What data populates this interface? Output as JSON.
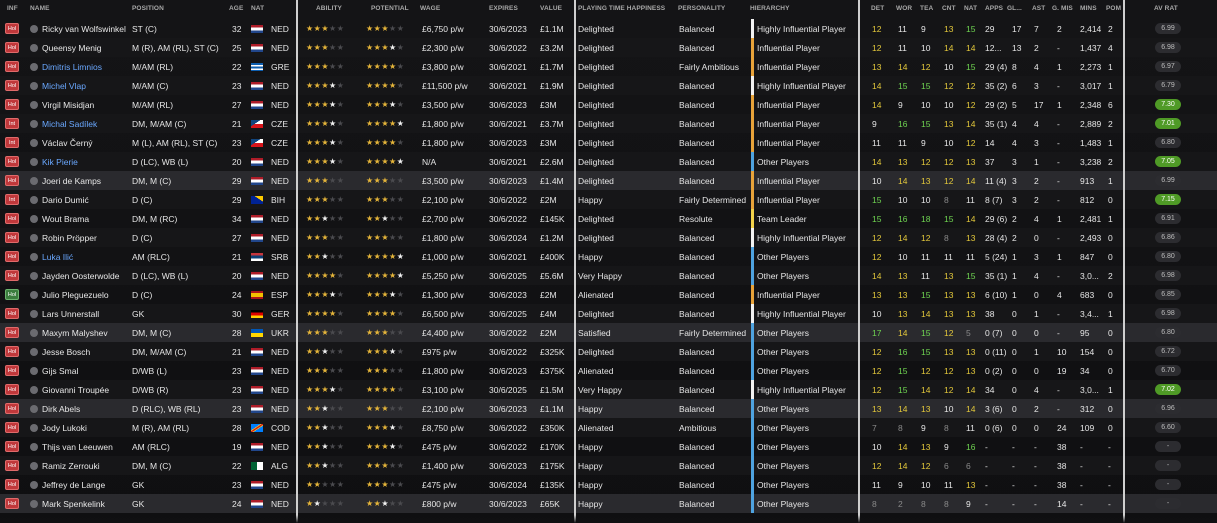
{
  "columns": {
    "inf": "INF",
    "name": "NAME",
    "position": "POSITION",
    "age": "AGE",
    "nat": "NAT",
    "ability": "ABILITY",
    "potential": "POTENTIAL",
    "wage": "WAGE",
    "expires": "EXPIRES",
    "value": "VALUE",
    "happiness": "PLAYING TIME HAPPINESS",
    "personality": "PERSONALITY",
    "hierarchy": "HIERARCHY",
    "det": "DET",
    "wor": "WOR",
    "tea": "TEA",
    "cnt": "CNT",
    "nat2": "NAT",
    "apps": "APPS",
    "gls": "GL...",
    "ast": "AST",
    "gmis": "G. MIS",
    "mins": "MINS",
    "pom": "POM",
    "avrat": "AV RAT"
  },
  "colors": {
    "Highly Influential Player": "#f2f2f2",
    "Influential Player": "#e8a33a",
    "Team Leader": "#f2d24a",
    "Other Players": "#4fa3e0",
    "flag_icons": "flag-icons"
  },
  "rows": [
    {
      "inf": "Hol",
      "ig": 0,
      "name": "Ricky van Wolfswinkel",
      "blue": 0,
      "pos": "ST (C)",
      "age": "32",
      "nat": "NED",
      "ab": 3,
      "pot": 3,
      "wage": "£6,750 p/w",
      "exp": "30/6/2023",
      "val": "£1.1M",
      "hap": "Delighted",
      "per": "Balanced",
      "hie": "Highly Influential Player",
      "det": "12",
      "wor": "11",
      "tea": "9",
      "cnt": "13",
      "nat2": "15",
      "apps": "29",
      "gls": "17",
      "ast": "7",
      "gmis": "2",
      "mins": "2,414",
      "pom": "2",
      "rat": "6.99",
      "hi": 0
    },
    {
      "inf": "Hol",
      "ig": 0,
      "name": "Queensy Menig",
      "blue": 0,
      "pos": "M (R), AM (RL), ST (C)",
      "age": "25",
      "nat": "NED",
      "ab": 3,
      "pot": 3.5,
      "wage": "£2,300 p/w",
      "exp": "30/6/2022",
      "val": "£3.2M",
      "hap": "Delighted",
      "per": "Balanced",
      "hie": "Influential Player",
      "det": "12",
      "wor": "11",
      "tea": "10",
      "cnt": "14",
      "nat2": "14",
      "apps": "12...",
      "gls": "13",
      "ast": "2",
      "gmis": "-",
      "mins": "1,437",
      "pom": "4",
      "rat": "6.98",
      "hi": 0
    },
    {
      "inf": "Hol",
      "ig": 0,
      "name": "Dimitris Limnios",
      "blue": 1,
      "pos": "M/AM (RL)",
      "age": "22",
      "nat": "GRE",
      "ab": 3,
      "pot": 4,
      "wage": "£3,800 p/w",
      "exp": "30/6/2021",
      "val": "£1.7M",
      "hap": "Delighted",
      "per": "Fairly Ambitious",
      "hie": "Influential Player",
      "det": "13",
      "wor": "14",
      "tea": "12",
      "cnt": "10",
      "nat2": "15",
      "apps": "29 (4)",
      "gls": "8",
      "ast": "4",
      "gmis": "1",
      "mins": "2,273",
      "pom": "1",
      "rat": "6.97",
      "hi": 0
    },
    {
      "inf": "Hol",
      "ig": 0,
      "name": "Michel Vlap",
      "blue": 1,
      "pos": "M/AM (C)",
      "age": "23",
      "nat": "NED",
      "ab": 3.5,
      "pot": 4,
      "wage": "£11,500 p/w",
      "exp": "30/6/2021",
      "val": "£1.9M",
      "hap": "Delighted",
      "per": "Balanced",
      "hie": "Highly Influential Player",
      "det": "14",
      "wor": "15",
      "tea": "15",
      "cnt": "12",
      "nat2": "12",
      "apps": "35 (2)",
      "gls": "6",
      "ast": "3",
      "gmis": "-",
      "mins": "3,017",
      "pom": "1",
      "rat": "6.79",
      "hi": 0
    },
    {
      "inf": "Hol",
      "ig": 0,
      "name": "Virgil Misidjan",
      "blue": 0,
      "pos": "M/AM (RL)",
      "age": "27",
      "nat": "NED",
      "ab": 3.5,
      "pot": 3.5,
      "wage": "£3,500 p/w",
      "exp": "30/6/2023",
      "val": "£3M",
      "hap": "Delighted",
      "per": "Balanced",
      "hie": "Influential Player",
      "det": "14",
      "wor": "9",
      "tea": "10",
      "cnt": "10",
      "nat2": "12",
      "apps": "29 (2)",
      "gls": "5",
      "ast": "17",
      "gmis": "1",
      "mins": "2,348",
      "pom": "6",
      "rat": "7.30",
      "hi": 1
    },
    {
      "inf": "Int",
      "ig": 0,
      "name": "Michal Sadílek",
      "blue": 1,
      "pos": "DM, M/AM (C)",
      "age": "21",
      "nat": "CZE",
      "ab": 3.5,
      "pot": 4.5,
      "wage": "£1,800 p/w",
      "exp": "30/6/2021",
      "val": "£3.7M",
      "hap": "Delighted",
      "per": "Balanced",
      "hie": "Influential Player",
      "det": "9",
      "wor": "16",
      "tea": "15",
      "cnt": "13",
      "nat2": "14",
      "apps": "35 (1)",
      "gls": "4",
      "ast": "4",
      "gmis": "-",
      "mins": "2,889",
      "pom": "2",
      "rat": "7.01",
      "hi": 1
    },
    {
      "inf": "Int",
      "ig": 0,
      "name": "Václav Černý",
      "blue": 0,
      "pos": "M (L), AM (RL), ST (C)",
      "age": "23",
      "nat": "CZE",
      "ab": 3.5,
      "pot": 4,
      "wage": "£1,800 p/w",
      "exp": "30/6/2023",
      "val": "£3M",
      "hap": "Delighted",
      "per": "Balanced",
      "hie": "Influential Player",
      "det": "11",
      "wor": "11",
      "tea": "9",
      "cnt": "10",
      "nat2": "12",
      "apps": "14",
      "gls": "4",
      "ast": "3",
      "gmis": "-",
      "mins": "1,483",
      "pom": "1",
      "rat": "6.80",
      "hi": 0
    },
    {
      "inf": "Hol",
      "ig": 0,
      "name": "Kik Pierie",
      "blue": 1,
      "pos": "D (LC), WB (L)",
      "age": "20",
      "nat": "NED",
      "ab": 3.5,
      "pot": 4.5,
      "wage": "N/A",
      "exp": "30/6/2021",
      "val": "£2.6M",
      "hap": "Delighted",
      "per": "Balanced",
      "hie": "Other Players",
      "det": "14",
      "wor": "13",
      "tea": "12",
      "cnt": "12",
      "nat2": "13",
      "apps": "37",
      "gls": "3",
      "ast": "1",
      "gmis": "-",
      "mins": "3,238",
      "pom": "2",
      "rat": "7.05",
      "hi": 1
    },
    {
      "inf": "Hol",
      "ig": 0,
      "name": "Joeri de Kamps",
      "blue": 0,
      "pos": "DM, M (C)",
      "age": "29",
      "nat": "NED",
      "ab": 3,
      "pot": 3,
      "wage": "£3,500 p/w",
      "exp": "30/6/2023",
      "val": "£1.4M",
      "hap": "Delighted",
      "per": "Balanced",
      "hie": "Influential Player",
      "det": "10",
      "wor": "14",
      "tea": "13",
      "cnt": "12",
      "nat2": "14",
      "apps": "11 (4)",
      "gls": "3",
      "ast": "2",
      "gmis": "-",
      "mins": "913",
      "pom": "1",
      "rat": "6.99",
      "hi": 0
    },
    {
      "inf": "Int",
      "ig": 0,
      "name": "Dario Dumić",
      "blue": 0,
      "pos": "D (C)",
      "age": "29",
      "nat": "BIH",
      "ab": 3,
      "pot": 3,
      "wage": "£2,100 p/w",
      "exp": "30/6/2022",
      "val": "£2M",
      "hap": "Happy",
      "per": "Fairly Determined",
      "hie": "Influential Player",
      "det": "15",
      "wor": "10",
      "tea": "10",
      "cnt": "8",
      "nat2": "11",
      "apps": "8 (7)",
      "gls": "3",
      "ast": "2",
      "gmis": "-",
      "mins": "812",
      "pom": "0",
      "rat": "7.15",
      "hi": 1
    },
    {
      "inf": "Hol",
      "ig": 0,
      "name": "Wout Brama",
      "blue": 0,
      "pos": "DM, M (RC)",
      "age": "34",
      "nat": "NED",
      "ab": 2.5,
      "pot": 2.5,
      "wage": "£2,700 p/w",
      "exp": "30/6/2022",
      "val": "£145K",
      "hap": "Delighted",
      "per": "Resolute",
      "hie": "Team Leader",
      "det": "15",
      "wor": "16",
      "tea": "18",
      "cnt": "15",
      "nat2": "14",
      "apps": "29 (6)",
      "gls": "2",
      "ast": "4",
      "gmis": "1",
      "mins": "2,481",
      "pom": "1",
      "rat": "6.91",
      "hi": 0
    },
    {
      "inf": "Hol",
      "ig": 0,
      "name": "Robin Pröpper",
      "blue": 0,
      "pos": "D (C)",
      "age": "27",
      "nat": "NED",
      "ab": 3,
      "pot": 3,
      "wage": "£1,800 p/w",
      "exp": "30/6/2024",
      "val": "£1.2M",
      "hap": "Delighted",
      "per": "Balanced",
      "hie": "Highly Influential Player",
      "det": "12",
      "wor": "14",
      "tea": "12",
      "cnt": "8",
      "nat2": "13",
      "apps": "28 (4)",
      "gls": "2",
      "ast": "0",
      "gmis": "-",
      "mins": "2,493",
      "pom": "0",
      "rat": "6.86",
      "hi": 0
    },
    {
      "inf": "Hol",
      "ig": 0,
      "name": "Luka Ilić",
      "blue": 1,
      "pos": "AM (RLC)",
      "age": "21",
      "nat": "SRB",
      "ab": 2.5,
      "pot": 4.5,
      "wage": "£1,000 p/w",
      "exp": "30/6/2021",
      "val": "£400K",
      "hap": "Happy",
      "per": "Balanced",
      "hie": "Other Players",
      "det": "12",
      "wor": "10",
      "tea": "11",
      "cnt": "11",
      "nat2": "11",
      "apps": "5 (24)",
      "gls": "1",
      "ast": "3",
      "gmis": "1",
      "mins": "847",
      "pom": "0",
      "rat": "6.80",
      "hi": 0
    },
    {
      "inf": "Hol",
      "ig": 0,
      "name": "Jayden Oosterwolde",
      "blue": 0,
      "pos": "D (LC), WB (L)",
      "age": "20",
      "nat": "NED",
      "ab": 4,
      "pot": 4.5,
      "wage": "£5,250 p/w",
      "exp": "30/6/2025",
      "val": "£5.6M",
      "hap": "Very Happy",
      "per": "Balanced",
      "hie": "Other Players",
      "det": "14",
      "wor": "13",
      "tea": "11",
      "cnt": "13",
      "nat2": "15",
      "apps": "35 (1)",
      "gls": "1",
      "ast": "4",
      "gmis": "-",
      "mins": "3,0...",
      "pom": "2",
      "rat": "6.98",
      "hi": 0
    },
    {
      "inf": "Hol",
      "ig": 1,
      "name": "Julio Pleguezuelo",
      "blue": 0,
      "pos": "D (C)",
      "age": "24",
      "nat": "ESP",
      "ab": 3.5,
      "pot": 3.5,
      "wage": "£1,300 p/w",
      "exp": "30/6/2023",
      "val": "£2M",
      "hap": "Alienated",
      "per": "Balanced",
      "hie": "Influential Player",
      "det": "13",
      "wor": "13",
      "tea": "15",
      "cnt": "13",
      "nat2": "13",
      "apps": "6 (10)",
      "gls": "1",
      "ast": "0",
      "gmis": "4",
      "mins": "683",
      "pom": "0",
      "rat": "6.85",
      "hi": 0
    },
    {
      "inf": "Hol",
      "ig": 0,
      "name": "Lars Unnerstall",
      "blue": 0,
      "pos": "GK",
      "age": "30",
      "nat": "GER",
      "ab": 4,
      "pot": 4,
      "wage": "£6,500 p/w",
      "exp": "30/6/2025",
      "val": "£4M",
      "hap": "Delighted",
      "per": "Balanced",
      "hie": "Highly Influential Player",
      "det": "10",
      "wor": "13",
      "tea": "14",
      "cnt": "13",
      "nat2": "13",
      "apps": "38",
      "gls": "0",
      "ast": "1",
      "gmis": "-",
      "mins": "3,4...",
      "pom": "1",
      "rat": "6.98",
      "hi": 0
    },
    {
      "inf": "Hol",
      "ig": 0,
      "name": "Maxym Malyshev",
      "blue": 0,
      "pos": "DM, M (C)",
      "age": "28",
      "nat": "UKR",
      "ab": 3,
      "pot": 3,
      "wage": "£4,400 p/w",
      "exp": "30/6/2022",
      "val": "£2M",
      "hap": "Satisfied",
      "per": "Fairly Determined",
      "hie": "Other Players",
      "det": "17",
      "wor": "14",
      "tea": "15",
      "cnt": "12",
      "nat2": "5",
      "apps": "0 (7)",
      "gls": "0",
      "ast": "0",
      "gmis": "-",
      "mins": "95",
      "pom": "0",
      "rat": "6.80",
      "hi": 0
    },
    {
      "inf": "Hol",
      "ig": 0,
      "name": "Jesse Bosch",
      "blue": 0,
      "pos": "DM, M/AM (C)",
      "age": "21",
      "nat": "NED",
      "ab": 2.5,
      "pot": 3.5,
      "wage": "£975 p/w",
      "exp": "30/6/2022",
      "val": "£325K",
      "hap": "Delighted",
      "per": "Balanced",
      "hie": "Other Players",
      "det": "12",
      "wor": "16",
      "tea": "15",
      "cnt": "13",
      "nat2": "13",
      "apps": "0 (11)",
      "gls": "0",
      "ast": "1",
      "gmis": "10",
      "mins": "154",
      "pom": "0",
      "rat": "6.72",
      "hi": 0
    },
    {
      "inf": "Hol",
      "ig": 0,
      "name": "Gijs Smal",
      "blue": 0,
      "pos": "D/WB (L)",
      "age": "23",
      "nat": "NED",
      "ab": 3,
      "pot": 3,
      "wage": "£1,800 p/w",
      "exp": "30/6/2023",
      "val": "£375K",
      "hap": "Alienated",
      "per": "Balanced",
      "hie": "Other Players",
      "det": "12",
      "wor": "15",
      "tea": "12",
      "cnt": "12",
      "nat2": "13",
      "apps": "0 (2)",
      "gls": "0",
      "ast": "0",
      "gmis": "19",
      "mins": "34",
      "pom": "0",
      "rat": "6.70",
      "hi": 0
    },
    {
      "inf": "Hol",
      "ig": 0,
      "name": "Giovanni Troupée",
      "blue": 0,
      "pos": "D/WB (R)",
      "age": "23",
      "nat": "NED",
      "ab": 3.5,
      "pot": 4,
      "wage": "£3,100 p/w",
      "exp": "30/6/2025",
      "val": "£1.5M",
      "hap": "Very Happy",
      "per": "Balanced",
      "hie": "Highly Influential Player",
      "det": "12",
      "wor": "15",
      "tea": "14",
      "cnt": "12",
      "nat2": "14",
      "apps": "34",
      "gls": "0",
      "ast": "4",
      "gmis": "-",
      "mins": "3,0...",
      "pom": "1",
      "rat": "7.02",
      "hi": 1
    },
    {
      "inf": "Hol",
      "ig": 0,
      "name": "Dirk Abels",
      "blue": 0,
      "pos": "D (RLC), WB (RL)",
      "age": "23",
      "nat": "NED",
      "ab": 2.5,
      "pot": 3,
      "wage": "£2,100 p/w",
      "exp": "30/6/2023",
      "val": "£1.1M",
      "hap": "Happy",
      "per": "Balanced",
      "hie": "Other Players",
      "det": "13",
      "wor": "14",
      "tea": "13",
      "cnt": "10",
      "nat2": "14",
      "apps": "3 (6)",
      "gls": "0",
      "ast": "2",
      "gmis": "-",
      "mins": "312",
      "pom": "0",
      "rat": "6.96",
      "hi": 0
    },
    {
      "inf": "Hol",
      "ig": 0,
      "name": "Jody Lukoki",
      "blue": 0,
      "pos": "M (R), AM (RL)",
      "age": "28",
      "nat": "COD",
      "ab": 2.5,
      "pot": 3.5,
      "wage": "£8,750 p/w",
      "exp": "30/6/2022",
      "val": "£350K",
      "hap": "Alienated",
      "per": "Ambitious",
      "hie": "Other Players",
      "det": "7",
      "wor": "8",
      "tea": "9",
      "cnt": "8",
      "nat2": "11",
      "apps": "0 (6)",
      "gls": "0",
      "ast": "0",
      "gmis": "24",
      "mins": "109",
      "pom": "0",
      "rat": "6.60",
      "hi": 0
    },
    {
      "inf": "Hol",
      "ig": 0,
      "name": "Thijs van Leeuwen",
      "blue": 0,
      "pos": "AM (RLC)",
      "age": "19",
      "nat": "NED",
      "ab": 2.5,
      "pot": 3.5,
      "wage": "£475 p/w",
      "exp": "30/6/2022",
      "val": "£170K",
      "hap": "Happy",
      "per": "Balanced",
      "hie": "Other Players",
      "det": "10",
      "wor": "14",
      "tea": "13",
      "cnt": "9",
      "nat2": "16",
      "apps": "-",
      "gls": "-",
      "ast": "-",
      "gmis": "38",
      "mins": "-",
      "pom": "-",
      "rat": "-",
      "hi": 0
    },
    {
      "inf": "Hol",
      "ig": 0,
      "name": "Ramiz Zerrouki",
      "blue": 0,
      "pos": "DM, M (C)",
      "age": "22",
      "nat": "ALG",
      "ab": 2.5,
      "pot": 3,
      "wage": "£1,400 p/w",
      "exp": "30/6/2023",
      "val": "£175K",
      "hap": "Happy",
      "per": "Balanced",
      "hie": "Other Players",
      "det": "12",
      "wor": "14",
      "tea": "12",
      "cnt": "6",
      "nat2": "6",
      "apps": "-",
      "gls": "-",
      "ast": "-",
      "gmis": "38",
      "mins": "-",
      "pom": "-",
      "rat": "-",
      "hi": 0
    },
    {
      "inf": "Hol",
      "ig": 0,
      "name": "Jeffrey de Lange",
      "blue": 0,
      "pos": "GK",
      "age": "23",
      "nat": "NED",
      "ab": 2,
      "pot": 3,
      "wage": "£475 p/w",
      "exp": "30/6/2024",
      "val": "£135K",
      "hap": "Happy",
      "per": "Balanced",
      "hie": "Other Players",
      "det": "11",
      "wor": "9",
      "tea": "10",
      "cnt": "11",
      "nat2": "13",
      "apps": "-",
      "gls": "-",
      "ast": "-",
      "gmis": "38",
      "mins": "-",
      "pom": "-",
      "rat": "-",
      "hi": 0
    },
    {
      "inf": "Hol",
      "ig": 0,
      "name": "Mark Spenkelink",
      "blue": 0,
      "pos": "GK",
      "age": "24",
      "nat": "NED",
      "ab": 1.5,
      "pot": 2.5,
      "wage": "£800 p/w",
      "exp": "30/6/2023",
      "val": "£65K",
      "hap": "Happy",
      "per": "Balanced",
      "hie": "Other Players",
      "det": "8",
      "wor": "2",
      "tea": "8",
      "cnt": "8",
      "nat2": "9",
      "apps": "-",
      "gls": "-",
      "ast": "-",
      "gmis": "14",
      "mins": "-",
      "pom": "-",
      "rat": "-",
      "hi": 0
    }
  ]
}
